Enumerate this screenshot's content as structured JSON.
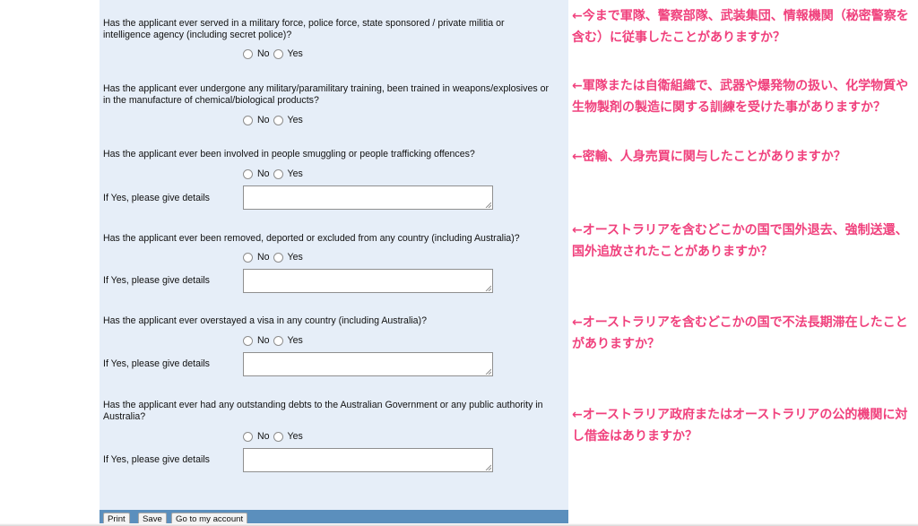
{
  "questions": [
    {
      "text": "Has the applicant ever served in a military force, police force, state sponsored / private militia or intelligence agency (including secret police)?",
      "options": [
        "No",
        "Yes"
      ],
      "details_label": null
    },
    {
      "text": "Has the applicant ever undergone any military/paramilitary training, been trained in weapons/explosives or in the manufacture of chemical/biological products?",
      "options": [
        "No",
        "Yes"
      ],
      "details_label": null
    },
    {
      "text": "Has the applicant ever been involved in people smuggling or people trafficking offences?",
      "options": [
        "No",
        "Yes"
      ],
      "details_label": "If Yes, please give details"
    },
    {
      "text": "Has the applicant ever been removed, deported or excluded from any country (including Australia)?",
      "options": [
        "No",
        "Yes"
      ],
      "details_label": "If Yes, please give details"
    },
    {
      "text": "Has the applicant ever overstayed a visa in any country (including Australia)?",
      "options": [
        "No",
        "Yes"
      ],
      "details_label": "If Yes, please give details"
    },
    {
      "text": "Has the applicant ever had any outstanding debts to the Australian Government or any public authority in Australia?",
      "options": [
        "No",
        "Yes"
      ],
      "details_label": "If Yes, please give details"
    }
  ],
  "toolbar": {
    "print_label": "Print",
    "save_label": "Save",
    "account_label": "Go to my account"
  },
  "annotations": [
    "←今まで軍隊、警察部隊、武装集団、情報機関（秘密警察を含む）に従事したことがありますか？",
    "←軍隊または自衛組織で、武器や爆発物の扱い、化学物質や生物製剤の製造に関する訓練を受けた事がありますか？",
    "←密輸、人身売買に関与したことがありますか？",
    "←オーストラリアを含むどこかの国で国外退去、強制送還、国外追放されたことがありますか？",
    "←オーストラリアを含むどこかの国で不法長期滞在したことがありますか？",
    "←オーストラリア政府またはオーストラリアの公的機関に対し借金はありますか？"
  ],
  "colors": {
    "annotation": "#f0417d",
    "panel_background": "#e6eef8",
    "toolbar_background": "#5b8fbd"
  }
}
